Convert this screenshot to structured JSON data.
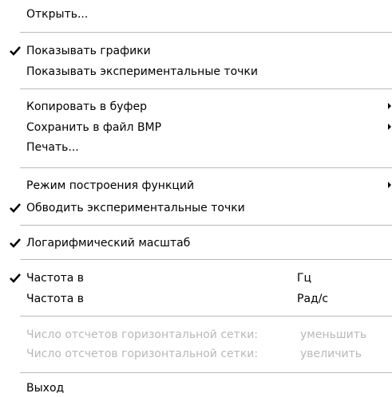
{
  "menu": {
    "open": "Открыть...",
    "show_graphs": "Показывать графики",
    "show_exp_points": "Показывать экспериментальные точки",
    "copy_to_buffer": "Копировать в буфер",
    "save_bmp": "Сохранить в файл BMP",
    "print": "Печать...",
    "plot_mode": "Режим построения функций",
    "outline_exp_points": "Обводить экспериментальные точки",
    "log_scale": "Логарифмический масштаб",
    "freq_hz_label": "Частота в",
    "freq_hz_unit": "Гц",
    "freq_rad_label": "Частота в",
    "freq_rad_unit": "Рад/с",
    "grid_decrease_label": "Число отсчетов горизонтальной сетки:",
    "grid_decrease_action": "уменьшить",
    "grid_increase_label": "Число отсчетов горизонтальной сетки:",
    "grid_increase_action": "увеличить",
    "exit": "Выход"
  },
  "checked": {
    "show_graphs": true,
    "outline_exp_points": true,
    "log_scale": true,
    "freq_hz": true
  }
}
